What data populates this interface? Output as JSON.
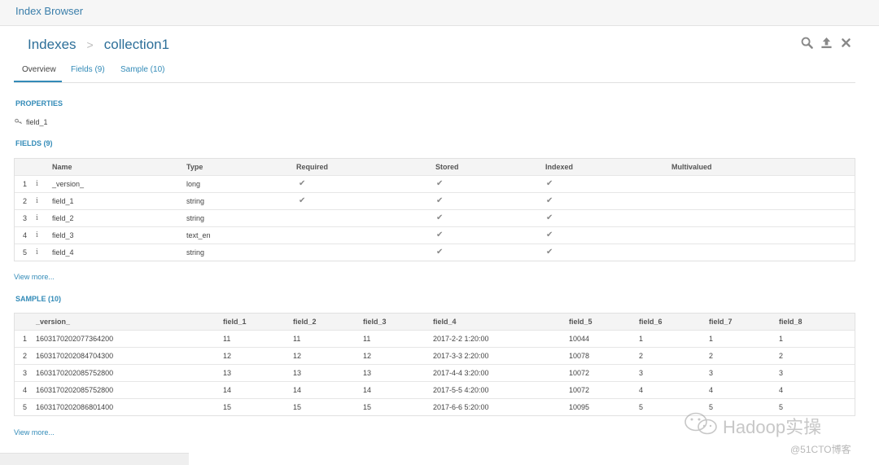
{
  "app": {
    "title": "Index Browser"
  },
  "breadcrumb": {
    "root": "Indexes",
    "separator": ">",
    "current": "collection1"
  },
  "toolbar": {
    "icons": [
      "search-icon",
      "upload-icon",
      "close-icon"
    ]
  },
  "tabs": [
    {
      "label": "Overview",
      "active": true
    },
    {
      "label": "Fields (9)",
      "active": false
    },
    {
      "label": "Sample (10)",
      "active": false
    }
  ],
  "properties": {
    "heading": "PROPERTIES",
    "key_field": "field_1"
  },
  "fields": {
    "heading": "FIELDS (9)",
    "columns": [
      "Name",
      "Type",
      "Required",
      "Stored",
      "Indexed",
      "Multivalued"
    ],
    "rows": [
      {
        "num": "1",
        "name": "_version_",
        "type": "long",
        "required": true,
        "stored": true,
        "indexed": true,
        "multivalued": false
      },
      {
        "num": "2",
        "name": "field_1",
        "type": "string",
        "required": true,
        "stored": true,
        "indexed": true,
        "multivalued": false
      },
      {
        "num": "3",
        "name": "field_2",
        "type": "string",
        "required": false,
        "stored": true,
        "indexed": true,
        "multivalued": false
      },
      {
        "num": "4",
        "name": "field_3",
        "type": "text_en",
        "required": false,
        "stored": true,
        "indexed": true,
        "multivalued": false
      },
      {
        "num": "5",
        "name": "field_4",
        "type": "string",
        "required": false,
        "stored": true,
        "indexed": true,
        "multivalued": false
      }
    ],
    "view_more": "View more..."
  },
  "sample": {
    "heading": "SAMPLE (10)",
    "columns": [
      "_version_",
      "field_1",
      "field_2",
      "field_3",
      "field_4",
      "field_5",
      "field_6",
      "field_7",
      "field_8"
    ],
    "rows": [
      {
        "num": "1",
        "values": [
          "1603170202077364200",
          "11",
          "11",
          "11",
          "2017-2-2 1:20:00",
          "10044",
          "1",
          "1",
          "1"
        ]
      },
      {
        "num": "2",
        "values": [
          "1603170202084704300",
          "12",
          "12",
          "12",
          "2017-3-3 2:20:00",
          "10078",
          "2",
          "2",
          "2"
        ]
      },
      {
        "num": "3",
        "values": [
          "1603170202085752800",
          "13",
          "13",
          "13",
          "2017-4-4 3:20:00",
          "10072",
          "3",
          "3",
          "3"
        ]
      },
      {
        "num": "4",
        "values": [
          "1603170202085752800",
          "14",
          "14",
          "14",
          "2017-5-5 4:20:00",
          "10072",
          "4",
          "4",
          "4"
        ]
      },
      {
        "num": "5",
        "values": [
          "1603170202086801400",
          "15",
          "15",
          "15",
          "2017-6-6 5:20:00",
          "10095",
          "5",
          "5",
          "5"
        ]
      }
    ],
    "view_more": "View more..."
  },
  "watermark": {
    "text": "Hadoop实操",
    "subtext": "@51CTO博客"
  },
  "colors": {
    "accent": "#338bb8",
    "title": "#2d6f99",
    "header_bg": "#f6f6f6"
  }
}
